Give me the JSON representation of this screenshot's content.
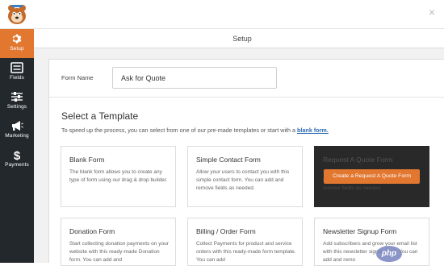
{
  "sidebar": {
    "items": [
      {
        "label": "Setup",
        "icon": "gear-icon",
        "active": true
      },
      {
        "label": "Fields",
        "icon": "fields-icon",
        "active": false
      },
      {
        "label": "Settings",
        "icon": "sliders-icon",
        "active": false
      },
      {
        "label": "Marketing",
        "icon": "megaphone-icon",
        "active": false
      },
      {
        "label": "Payments",
        "icon": "dollar-icon",
        "active": false
      }
    ]
  },
  "header": {
    "title": "Setup",
    "close_glyph": "×"
  },
  "form": {
    "name_label": "Form Name",
    "name_value": "Ask for Quote"
  },
  "template_section": {
    "title": "Select a Template",
    "description_prefix": "To speed up the process, you can select from one of our pre-made templates or start with a",
    "blank_link": "blank form."
  },
  "templates": [
    {
      "title": "Blank Form",
      "desc": "The blank form allows you to create any type of form using our drag & drop builder."
    },
    {
      "title": "Simple Contact Form",
      "desc": "Allow your users to contact you with this simple contact form. You can add and remove fields as needed."
    },
    {
      "title": "Request A Quote Form",
      "desc": "Start collecting leads with this pre-made Request a quote form. You can add and remove fields as needed.",
      "button": "Create a Request A Quote Form"
    },
    {
      "title": "Donation Form",
      "desc": "Start collecting donation payments on your website with this ready-made Donation form. You can add and"
    },
    {
      "title": "Billing / Order Form",
      "desc": "Collect Payments for product and service orders with this ready-made form template. You can add"
    },
    {
      "title": "Newsletter Signup Form",
      "desc": "Add subscribers and grow your email list with this newsletter signup form. You can add and remo"
    }
  ],
  "watermark": "php",
  "colors": {
    "accent": "#e27730",
    "sidebar": "#23282d",
    "link": "#2d6bb5"
  }
}
